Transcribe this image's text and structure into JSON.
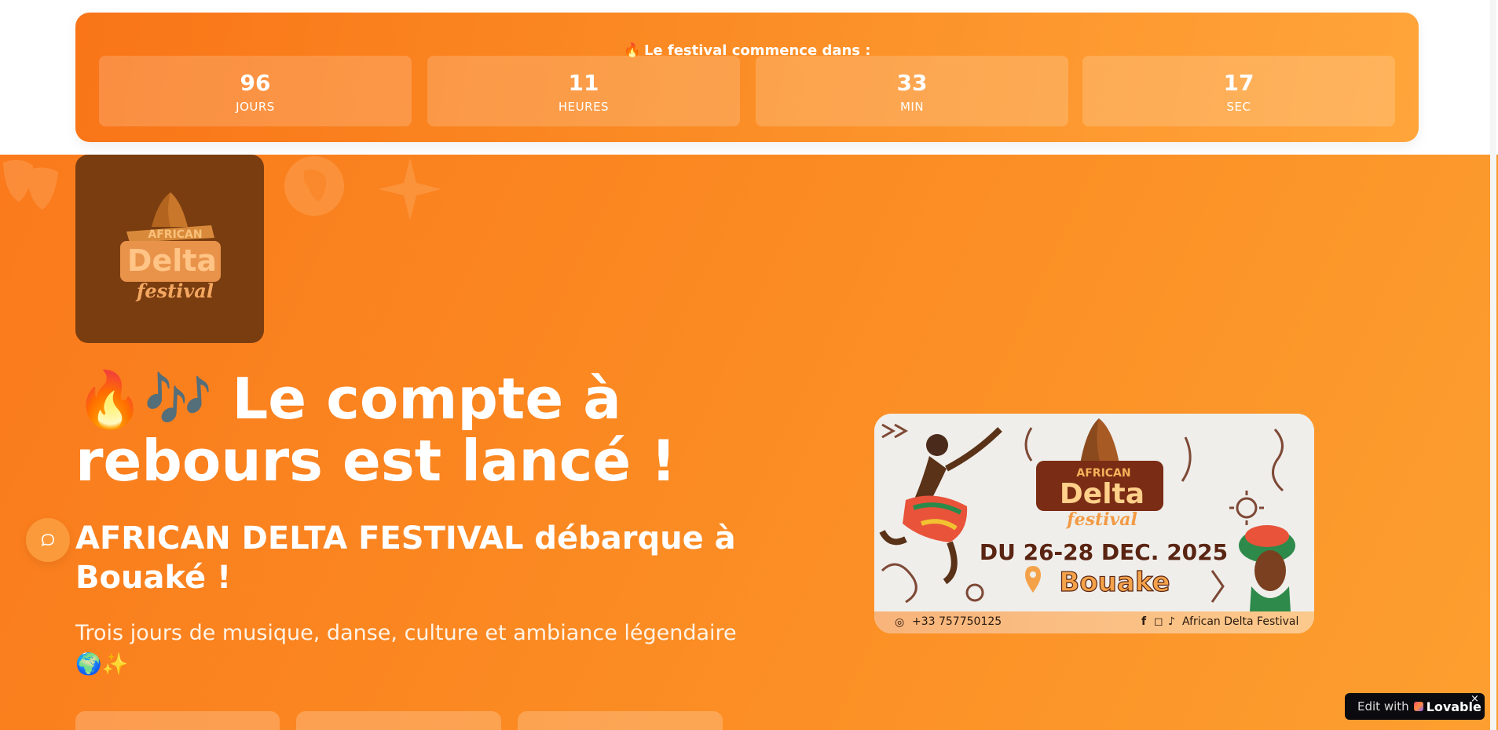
{
  "countdown": {
    "title": "Le festival commence dans :",
    "units": [
      {
        "value": "96",
        "label": "JOURS"
      },
      {
        "value": "11",
        "label": "HEURES"
      },
      {
        "value": "33",
        "label": "MIN"
      },
      {
        "value": "17",
        "label": "SEC"
      }
    ]
  },
  "hero": {
    "title": "Le compte à rebours est lancé !",
    "subtitle": "AFRICAN DELTA FESTIVAL débarque à Bouaké !",
    "description": "Trois jours de musique, danse, culture et ambiance légendaire"
  },
  "poster": {
    "logo_line1": "AFRICAN",
    "logo_line2": "Delta",
    "logo_line3": "festival",
    "dates": "DU 26-28 DEC. 2025",
    "city": "Bouake",
    "phone": "+33 757750125",
    "social": "African Delta Festival"
  },
  "logo_tile": {
    "line1": "AFRICAN",
    "line2": "Delta",
    "line3": "festival"
  },
  "badge": {
    "edit_label": "Edit with",
    "brand_label": "Lovable",
    "close_label": "×"
  },
  "colors": {
    "accent_orange": "#fa7a1c",
    "accent_light": "#ffa53a",
    "logo_bg": "#7a3d10",
    "poster_text": "#5a2412"
  },
  "icons": [
    "fire-icon",
    "music-notes-icon",
    "globe-icon",
    "sparkles-icon",
    "chat-icon",
    "whatsapp-icon",
    "facebook-icon",
    "instagram-icon",
    "tiktok-icon",
    "location-pin-icon"
  ]
}
